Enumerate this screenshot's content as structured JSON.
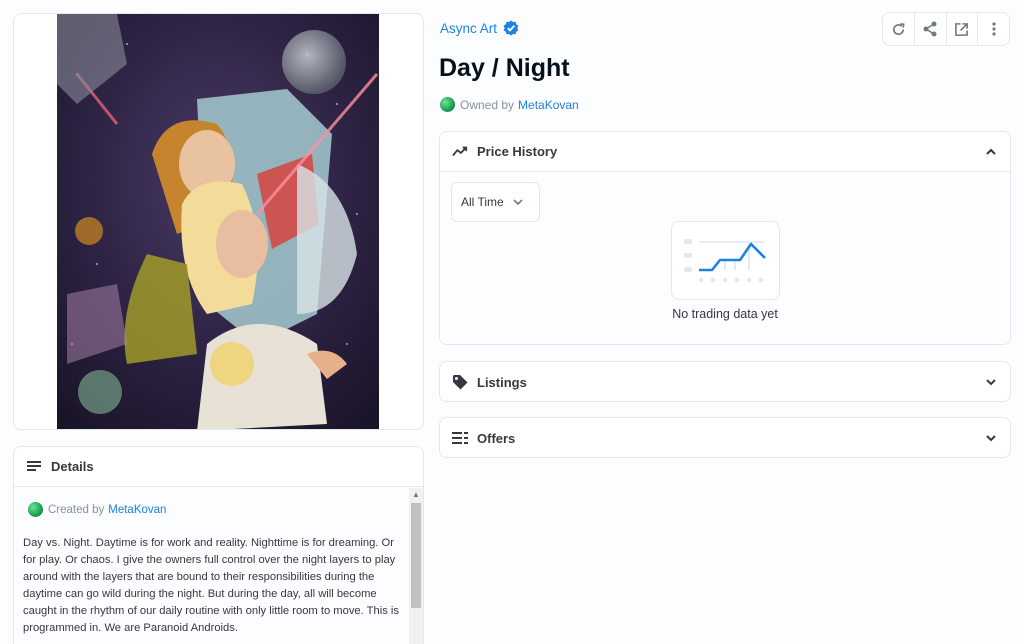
{
  "collection": {
    "name": "Async Art",
    "verified": true
  },
  "item": {
    "title": "Day / Night",
    "owner_prefix": "Owned by",
    "owner": "MetaKovan"
  },
  "actions": [
    {
      "name": "refresh-icon"
    },
    {
      "name": "share-icon"
    },
    {
      "name": "external-link-icon"
    },
    {
      "name": "more-icon"
    }
  ],
  "price_history": {
    "title": "Price History",
    "time_filter": "All Time",
    "empty_text": "No trading data yet"
  },
  "listings": {
    "title": "Listings"
  },
  "offers": {
    "title": "Offers"
  },
  "details": {
    "title": "Details",
    "creator_prefix": "Created by",
    "creator": "MetaKovan",
    "description": "Day vs. Night. Daytime is for work and reality. Nighttime is for dreaming. Or for play. Or chaos. I give the owners full control over the night layers to play around with the layers that are bound to their responsibilities during the daytime can go wild during the night. But during the day, all will become caught in the rhythm of our daily routine with only little room to move. This is programmed in. We are Paranoid Androids."
  },
  "colors": {
    "link": "#2081e2",
    "text": "#353840",
    "border": "#e5e8eb"
  }
}
